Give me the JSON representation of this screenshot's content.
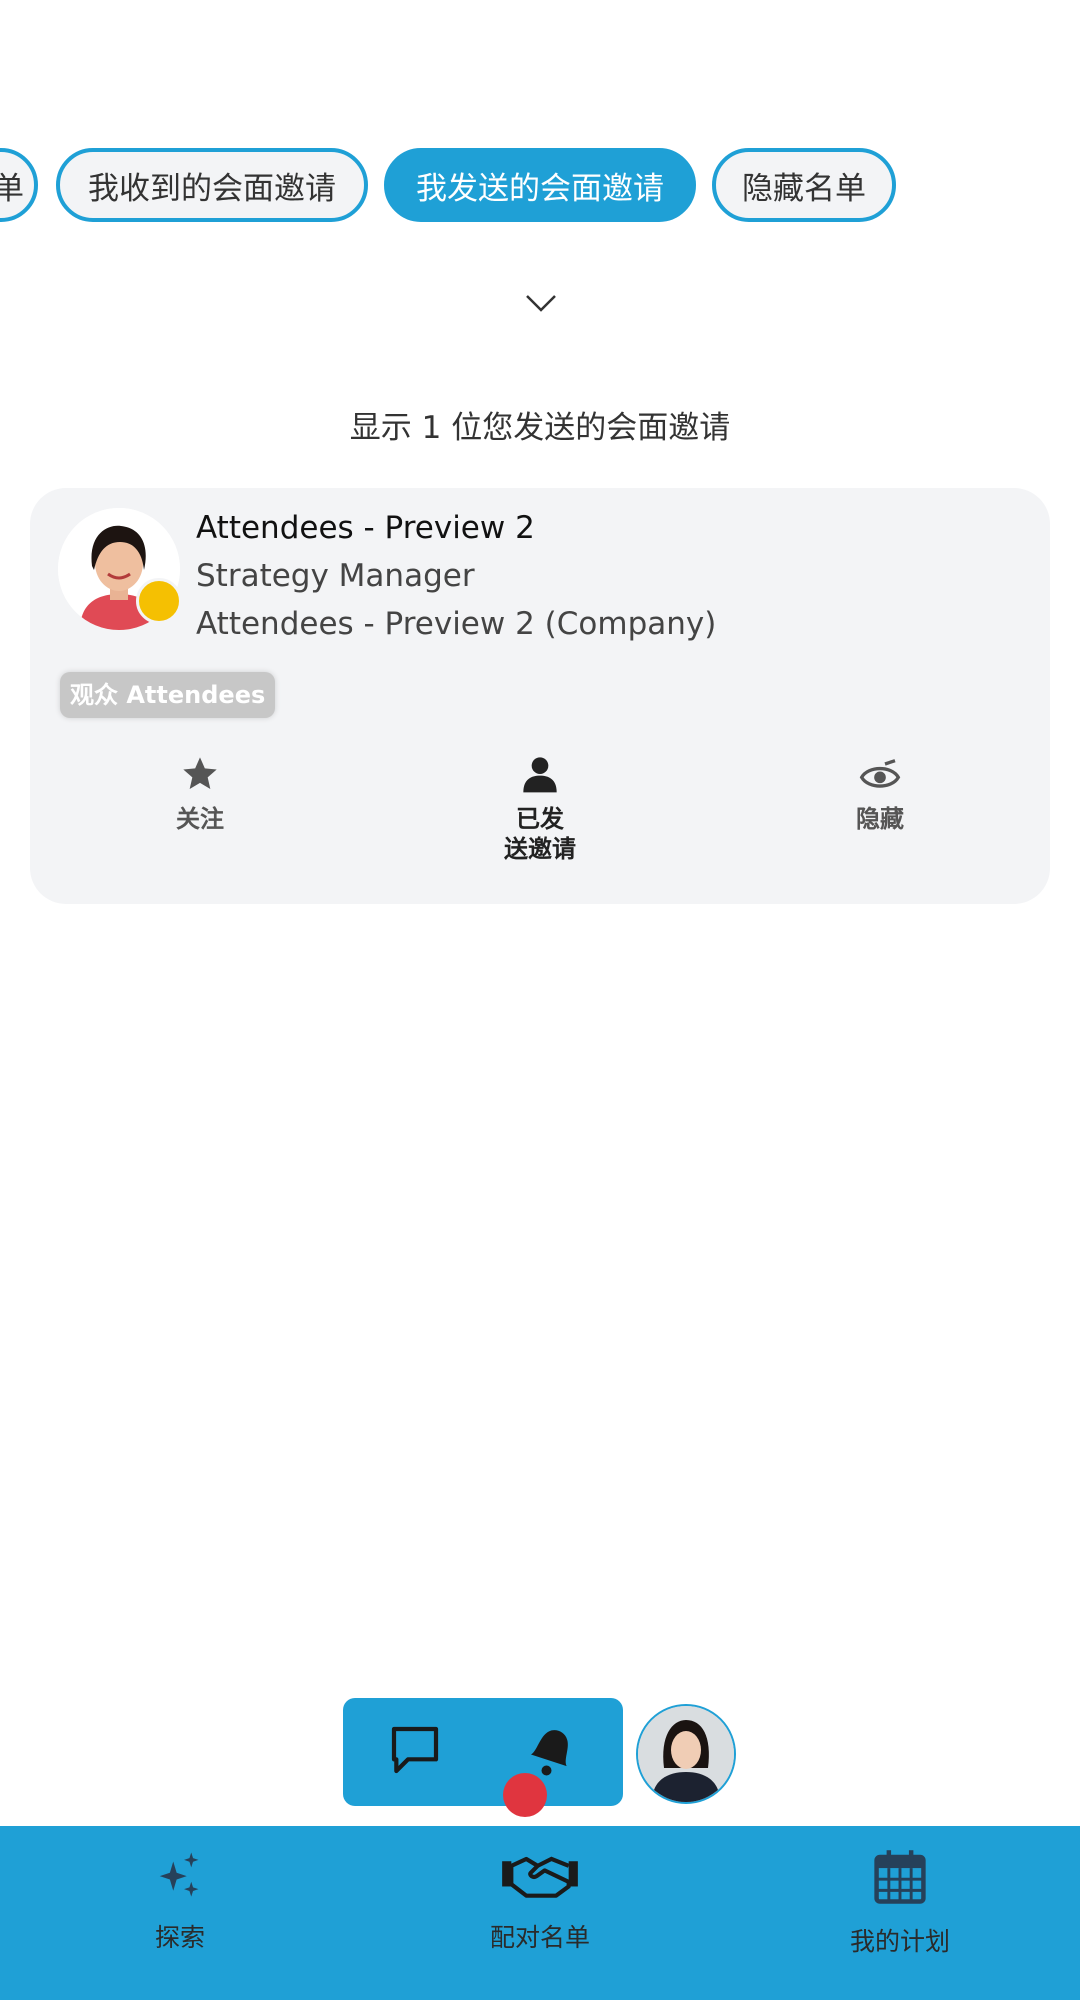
{
  "filters": {
    "partial_label": "单",
    "items": [
      {
        "label": "我收到的会面邀请",
        "active": false
      },
      {
        "label": "我发送的会面邀请",
        "active": true
      },
      {
        "label": "隐藏名单",
        "active": false
      }
    ]
  },
  "results_count_text": "显示 1 位您发送的会面邀请",
  "card": {
    "name": "Attendees - Preview 2",
    "job_title": "Strategy Manager",
    "company": "Attendees - Preview 2 (Company)",
    "tag": "观众 Attendees",
    "actions": {
      "follow": "关注",
      "invite_sent_line1": "已发",
      "invite_sent_line2": "送邀请",
      "hide": "隐藏"
    },
    "status_color": "#f5c002"
  },
  "toolbar": {
    "chat_icon": "chat-bubble-icon",
    "bell_icon": "bell-icon"
  },
  "bottom_nav": {
    "explore": "探索",
    "match_list": "配对名单",
    "my_plan": "我的计划"
  },
  "colors": {
    "accent": "#1fa0d6",
    "card_bg": "#f3f4f6",
    "notification": "#e0353f"
  }
}
